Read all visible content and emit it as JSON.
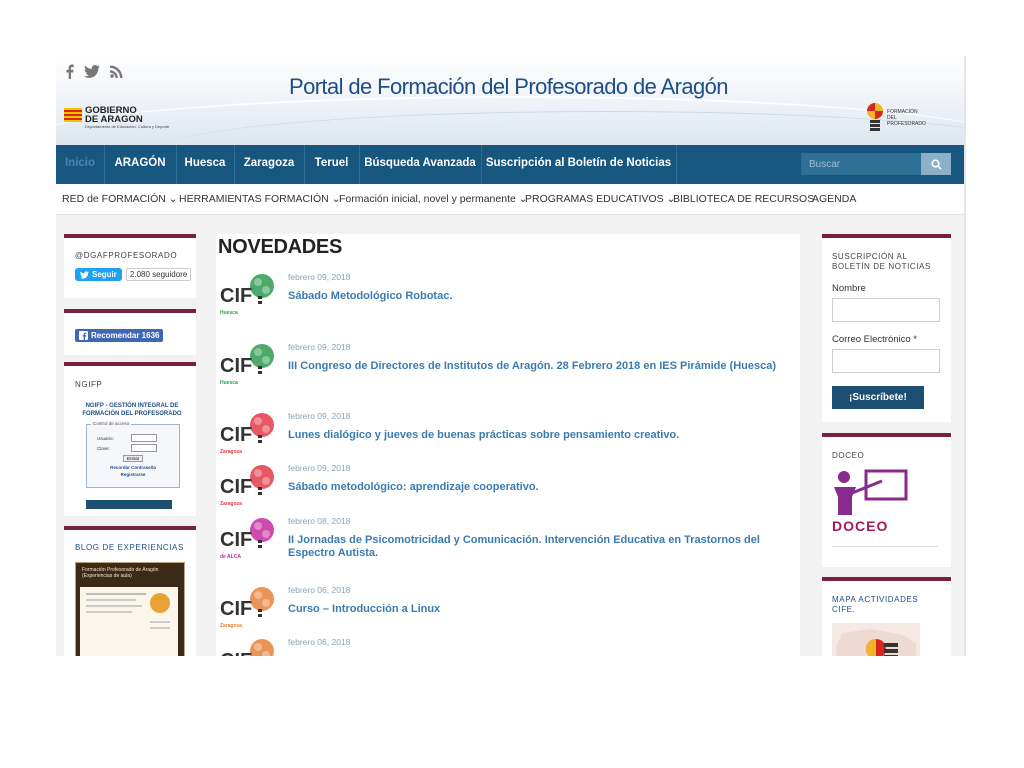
{
  "header": {
    "site_title": "Portal de Formación del Profesorado de Aragón",
    "social_icons": [
      "facebook-icon",
      "twitter-icon",
      "rss-icon"
    ],
    "gobierno_logo": [
      "GOBIERNO",
      "DE ARAGON",
      "Departamento de Educación, Cultura y Deporte"
    ],
    "formacion_logo": [
      "FORMACIÓN",
      "DEL",
      "PROFESORADO"
    ]
  },
  "nav": {
    "items": [
      "Inicio",
      "ARAGÓN",
      "Huesca",
      "Zaragoza",
      "Teruel",
      "Búsqueda Avanzada",
      "Suscripción al Boletín de Noticias"
    ],
    "active_index": 0,
    "search_placeholder": "Buscar"
  },
  "subnav": {
    "items": [
      "RED de FORMACIÓN",
      "HERRAMIENTAS FORMACIÓN",
      "Formación inicial, novel y permanente",
      "PROGRAMAS EDUCATIVOS",
      "BIBLIOTECA DE RECURSOS",
      "AGENDA"
    ]
  },
  "left_sidebar": {
    "twitter_widget": {
      "title": "@DGAFPROFESORADO",
      "follow_label": "Seguir",
      "followers": "2.080 seguidore"
    },
    "facebook_widget": {
      "recommend_label": "Recomendar 1636"
    },
    "ngifp_widget": {
      "title": "NGIFP",
      "subtitle": "NGIFP - GESTIÓN INTEGRAL DE FORMACIÓN DEL PROFESORADO",
      "box_title": "Control de acceso",
      "user_label": "Usuario:",
      "pass_label": "Clave:",
      "enter_label": "Entrar",
      "recover_label": "Recordar Contraseña",
      "register_label": "Registrarse"
    },
    "blog_widget": {
      "title": "BLOG DE EXPERIENCIAS",
      "blog_header": "Formación Profesorado de Aragón (Experiencias de aula)"
    }
  },
  "main": {
    "title": "NOVEDADES",
    "entries": [
      {
        "date": "febrero 09, 2018",
        "title": "Sábado Metodológico Robotac.",
        "logo_sub": "Huesca"
      },
      {
        "date": "febrero 09, 2018",
        "title": "III Congreso de Directores de Institutos de Aragón. 28 Febrero 2018 en IES Pirámide (Huesca)",
        "logo_sub": "Huesca"
      },
      {
        "date": "febrero 09, 2018",
        "title": "Lunes dialógico y jueves de buenas prácticas sobre pensamiento creativo.",
        "logo_sub": "Zaragoza"
      },
      {
        "date": "febrero 09, 2018",
        "title": "Sábado metodológico: aprendizaje cooperativo.",
        "logo_sub": "Zaragoza"
      },
      {
        "date": "febrero 08, 2018",
        "title": "II Jornadas de Psicomotricidad y Comunicación. Intervención Educativa en Trastornos del Espectro Autista.",
        "logo_sub": "de ALCA"
      },
      {
        "date": "febrero 06, 2018",
        "title": "Curso – Introducción a Linux",
        "logo_sub": "Zaragoza"
      },
      {
        "date": "febrero 06, 2018",
        "title": "",
        "logo_sub": ""
      }
    ]
  },
  "right_sidebar": {
    "subscribe_widget": {
      "title": "SUSCRIPCIÓN AL BOLETÍN DE NOTICIAS",
      "name_label": "Nombre",
      "email_label": "Correo Electrónico *",
      "button_label": "¡Suscríbete!"
    },
    "doceo_widget": {
      "title": "DOCEO",
      "logo_text": "DOCEO"
    },
    "map_widget": {
      "title": "MAPA ACTIVIDADES CIFE."
    }
  },
  "colors": {
    "nav_bg": "#17577f",
    "accent_bar": "#7a1f40",
    "link": "#3b7bb0",
    "title_blue": "#1d4e86",
    "doceo": "#a3195b"
  }
}
